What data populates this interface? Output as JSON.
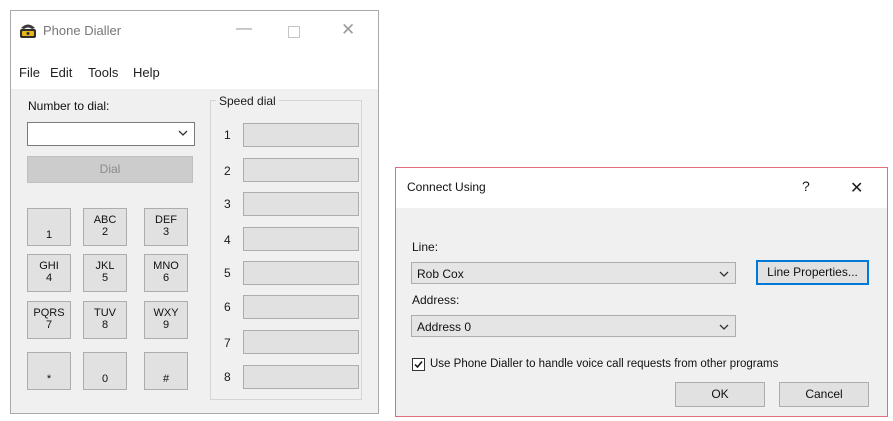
{
  "dialler": {
    "title": "Phone Dialler",
    "menu": [
      "File",
      "Edit",
      "Tools",
      "Help"
    ],
    "number_label": "Number to dial:",
    "number_value": "",
    "dial_button": "Dial",
    "speed_dial_title": "Speed dial",
    "speed_dial_numbers": [
      "1",
      "2",
      "3",
      "4",
      "5",
      "6",
      "7",
      "8"
    ],
    "keys": [
      {
        "top": "",
        "bottom": "1"
      },
      {
        "top": "ABC",
        "bottom": "2"
      },
      {
        "top": "DEF",
        "bottom": "3"
      },
      {
        "top": "GHI",
        "bottom": "4"
      },
      {
        "top": "JKL",
        "bottom": "5"
      },
      {
        "top": "MNO",
        "bottom": "6"
      },
      {
        "top": "PQRS",
        "bottom": "7"
      },
      {
        "top": "TUV",
        "bottom": "8"
      },
      {
        "top": "WXY",
        "bottom": "9"
      },
      {
        "top": "",
        "bottom": "*"
      },
      {
        "top": "",
        "bottom": "0"
      },
      {
        "top": "",
        "bottom": "#"
      }
    ]
  },
  "connect": {
    "title": "Connect Using",
    "help_glyph": "?",
    "close_glyph": "✕",
    "line_label": "Line:",
    "line_value": "Rob Cox",
    "line_properties_button": "Line Properties...",
    "address_label": "Address:",
    "address_value": "Address 0",
    "checkbox_label": "Use Phone Dialler to handle voice call requests from other programs",
    "checkbox_checked": true,
    "ok_button": "OK",
    "cancel_button": "Cancel"
  },
  "icons": {
    "app_icon": "phone-dialler-app-icon",
    "minimize": "minimize-icon",
    "maximize": "maximize-icon",
    "close": "close-icon",
    "dropdown": "chevron-down-icon",
    "check": "checkmark-icon"
  }
}
